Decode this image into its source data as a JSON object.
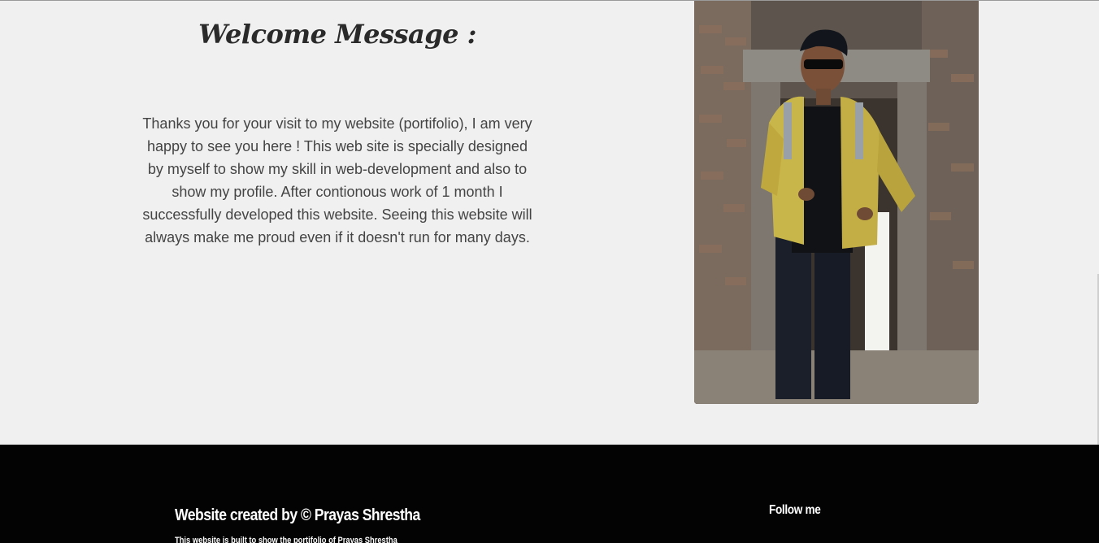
{
  "welcome": {
    "title": "Welcome Message :",
    "body": "Thanks you for your visit to my website (portifolio), I am very happy to see you here ! This web site is specially designed by myself to show my skill in web-development and also to show my profile. After contionous work of 1 month I successfully developed this website. Seeing this website will always make me proud even if it doesn't run for many days."
  },
  "footer": {
    "credit": "Website created by © Prayas Shrestha",
    "subtext": "This website is built to show the portifolio of Prayas Shrestha",
    "follow_title": "Follow me"
  }
}
